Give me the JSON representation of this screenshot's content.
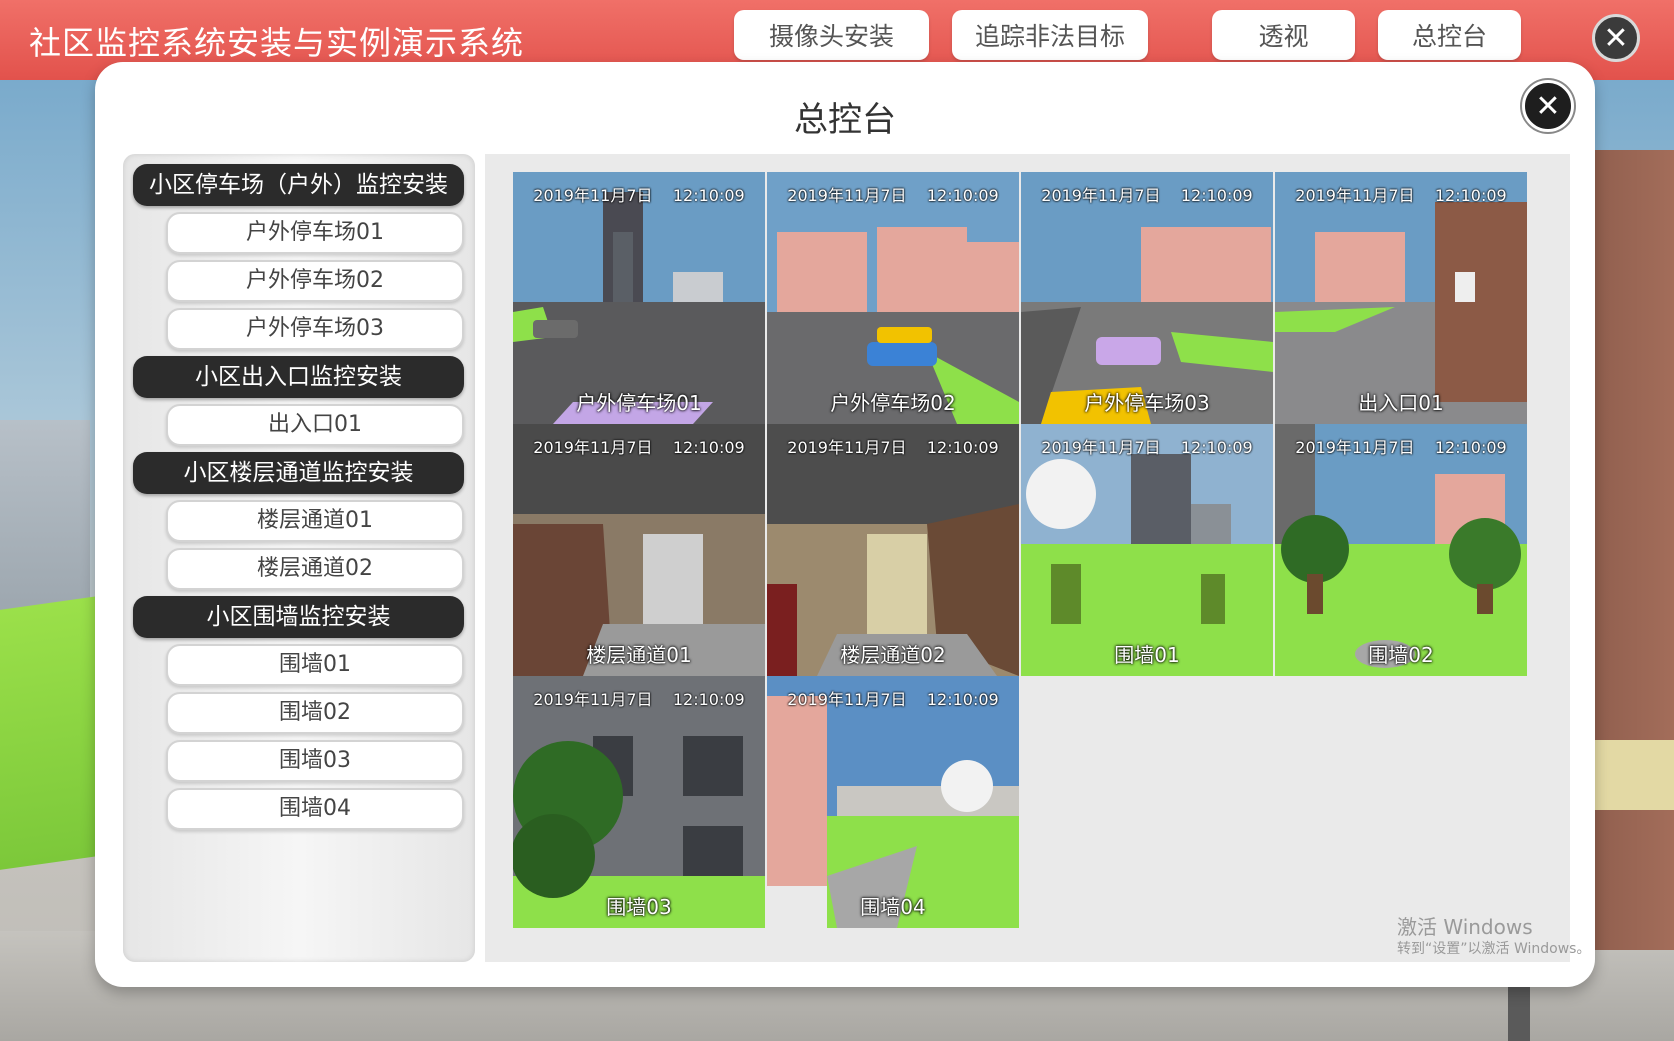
{
  "app": {
    "title": "社区监控系统安装与实例演示系统"
  },
  "nav": {
    "install": "摄像头安装",
    "track": "追踪非法目标",
    "perspective": "透视",
    "console": "总控台"
  },
  "dialog": {
    "title": "总控台"
  },
  "menu": {
    "cat_parking": "小区停车场（户外）监控安装",
    "parking_01": "户外停车场01",
    "parking_02": "户外停车场02",
    "parking_03": "户外停车场03",
    "cat_entrance": "小区出入口监控安装",
    "entrance_01": "出入口01",
    "cat_corridor": "小区楼层通道监控安装",
    "corridor_01": "楼层通道01",
    "corridor_02": "楼层通道02",
    "cat_wall": "小区围墙监控安装",
    "wall_01": "围墙01",
    "wall_02": "围墙02",
    "wall_03": "围墙03",
    "wall_04": "围墙04"
  },
  "cameras": [
    {
      "timestamp": "2019年11月7日    12:10:09",
      "label": "户外停车场01",
      "scene": "parking-icon"
    },
    {
      "timestamp": "2019年11月7日    12:10:09",
      "label": "户外停车场02",
      "scene": "parking-icon"
    },
    {
      "timestamp": "2019年11月7日    12:10:09",
      "label": "户外停车场03",
      "scene": "parking-icon"
    },
    {
      "timestamp": "2019年11月7日    12:10:09",
      "label": "出入口01",
      "scene": "entrance-icon"
    },
    {
      "timestamp": "2019年11月7日    12:10:09",
      "label": "楼层通道01",
      "scene": "stairs-icon"
    },
    {
      "timestamp": "2019年11月7日    12:10:09",
      "label": "楼层通道02",
      "scene": "corridor-icon"
    },
    {
      "timestamp": "2019年11月7日    12:10:09",
      "label": "围墙01",
      "scene": "wall-icon"
    },
    {
      "timestamp": "2019年11月7日    12:10:09",
      "label": "围墙02",
      "scene": "wall-icon"
    },
    {
      "timestamp": "2019年11月7日    12:10:09",
      "label": "围墙03",
      "scene": "wall-icon"
    },
    {
      "timestamp": "2019年11月7日    12:10:09",
      "label": "围墙04",
      "scene": "wall-icon"
    }
  ],
  "watermark": {
    "line1": "激活 Windows",
    "line2": "转到“设置”以激活 Windows。"
  },
  "colors": {
    "topbar": "#e85a52",
    "category_bg": "#2b2b2b",
    "grass": "#8ee04a"
  }
}
